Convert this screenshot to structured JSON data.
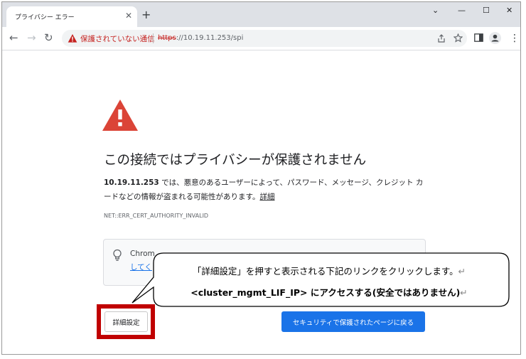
{
  "browser": {
    "tab_title": "プライバシー エラー",
    "tab_close": "✕",
    "new_tab": "+",
    "window_controls": {
      "collapse": "⌄",
      "minimize": "—",
      "maximize": "☐",
      "close": "✕"
    },
    "nav": {
      "back": "←",
      "forward": "→",
      "reload": "↻"
    },
    "security_label": "保護されていない通信",
    "url_scheme": "https",
    "url_rest": "://10.19.11.253/spi",
    "menu_icon": "⋮",
    "icons": [
      "share-icon",
      "star-icon",
      "side-panel-icon",
      "profile-icon",
      "more-menu-icon"
    ]
  },
  "page": {
    "heading": "この接続ではプライバシーが保護されません",
    "description_host": "10.19.11.253",
    "description_text": " では、悪意のあるユーザーによって、パスワード、メッセージ、クレジット カードなどの情報が盗まれる可能性があります。",
    "description_link": "詳細",
    "error_code": "NET::ERR_CERT_AUTHORITY_INVALID",
    "hint_line1": "Chrom",
    "hint_line2": "してく",
    "advanced_button": "詳細設定",
    "back_button": "セキュリティで保護されたページに戻る"
  },
  "callout": {
    "line1": "「詳細設定」を押すと表示される下記のリンクをクリックします。",
    "line2_bold": "<cluster_mgmt_LIF_IP>",
    "line2_rest": " にアクセスする(安全ではありません)",
    "return_mark": "↵"
  },
  "colors": {
    "warning_red": "#db4437",
    "insecure_red": "#c5221f",
    "primary_blue": "#1a73e8",
    "highlight_red": "#c00000"
  }
}
